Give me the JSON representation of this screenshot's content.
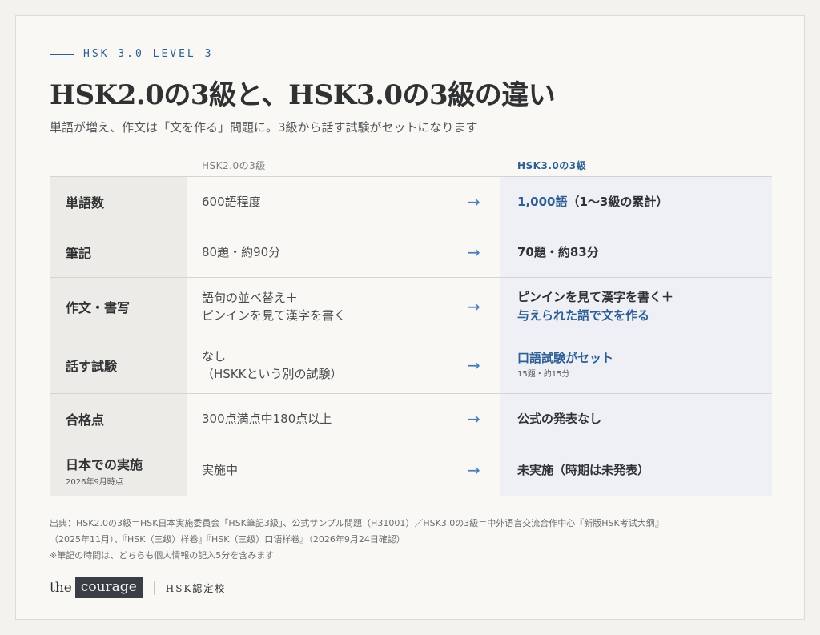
{
  "eyebrow": "HSK 3.0 LEVEL 3",
  "title": "HSK2.0の3級と、HSK3.0の3級の違い",
  "subtitle": "単語が増え、作文は「文を作る」問題に。3級から話す試験がセットになります",
  "table": {
    "col_old": "HSK2.0の3級",
    "col_new": "HSK3.0の3級",
    "arrow": "→",
    "rows": [
      {
        "label": "単語数",
        "old": "600語程度",
        "new_a": "1,000語",
        "new_b": "（1〜3級の累計）"
      },
      {
        "label": "筆記",
        "old": "80題・約90分",
        "new_a": "70題・約83分"
      },
      {
        "label": "作文・書写",
        "old_1": "語句の並べ替え＋",
        "old_2": "ピンインを見て漢字を書く",
        "new_a": "ピンインを見て漢字を書く＋",
        "new_b": "与えられた語で文を作る"
      },
      {
        "label": "話す試験",
        "old_1": "なし",
        "old_2": "（HSKKという別の試験）",
        "new_a": "口語試験がセット",
        "new_small": "15題・約15分"
      },
      {
        "label": "合格点",
        "old": "300点満点中180点以上",
        "new_a": "公式の発表なし"
      },
      {
        "label": "日本での実施",
        "note": "2026年9月時点",
        "old": "実施中",
        "new_a": "未実施（時期は未発表）"
      }
    ]
  },
  "source_1": "出典：HSK2.0の3級＝HSK日本実施委員会「HSK筆記3級」、公式サンプル問題（H31001）／HSK3.0の3級＝中外语言交流合作中心『新版HSK考试大纲』",
  "source_2": "（2025年11月）、『HSK（三级）样卷』『HSK（三级）口语样卷』（2026年9月24日確認）",
  "source_3": "※筆記の時間は、どちらも個人情報の記入5分を含みます",
  "brand": {
    "the": "the",
    "courage": "courage",
    "cert": "HSK認定校"
  },
  "colors": {
    "accent": "#2d5f94",
    "arrow": "#4a7eb6",
    "label_bg": "#ecebe7",
    "new_bg": "#eef0f5"
  }
}
